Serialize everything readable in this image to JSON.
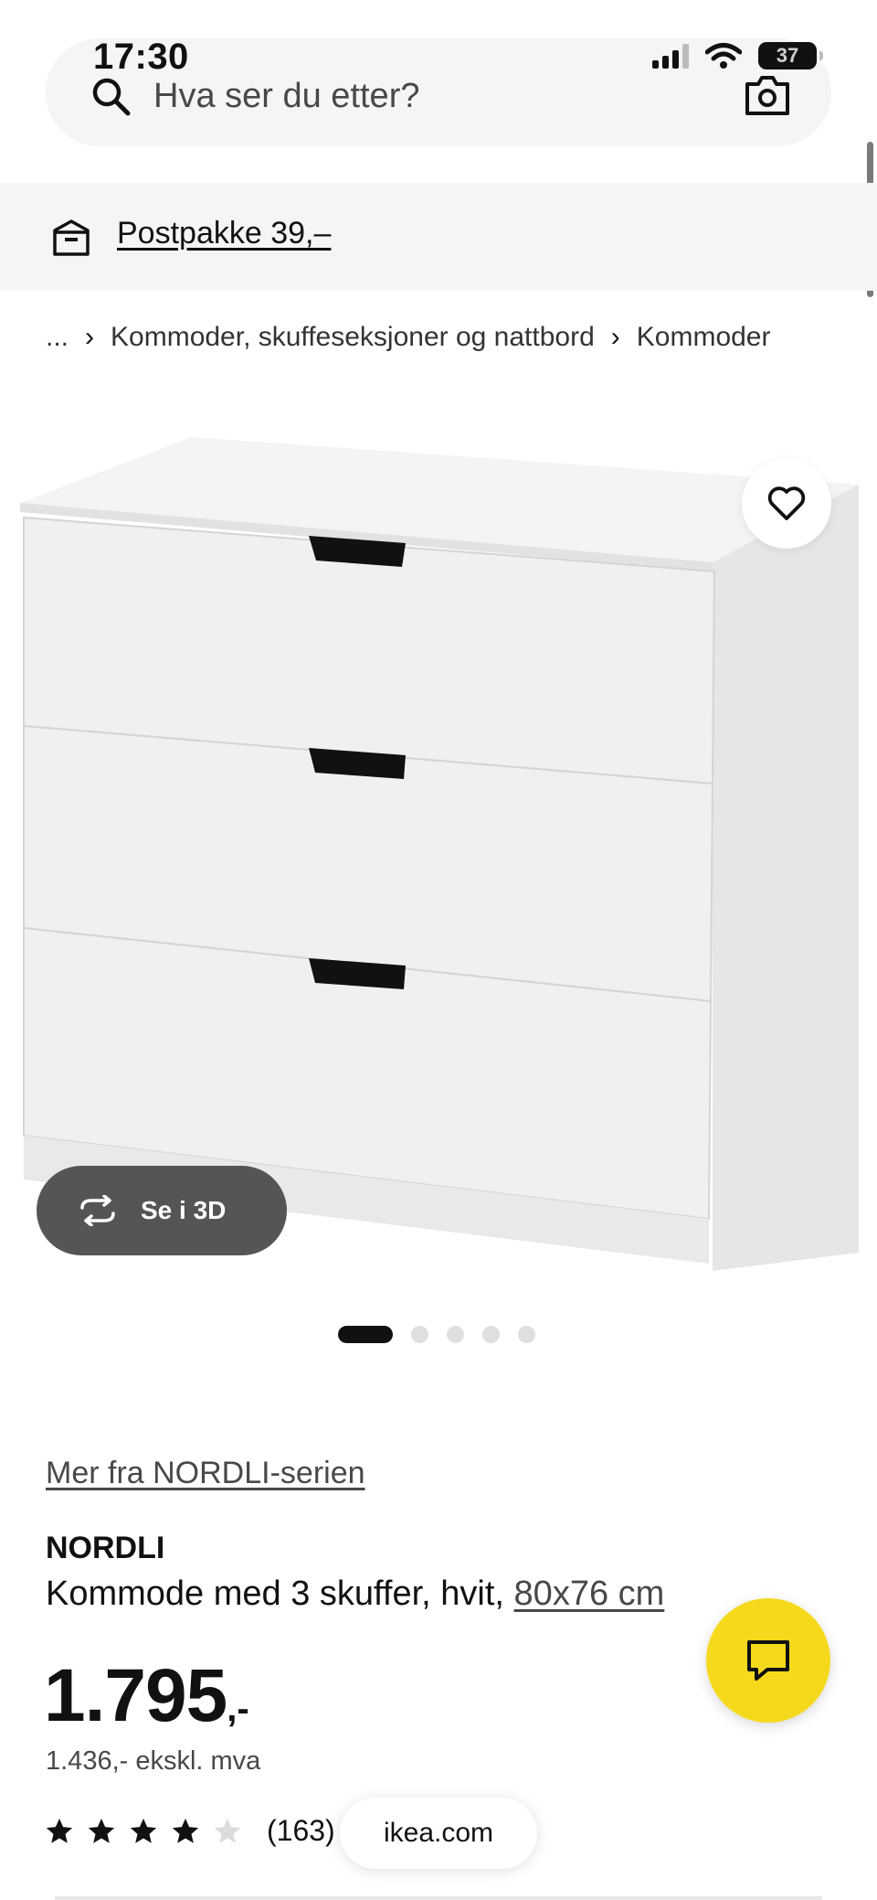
{
  "status_bar": {
    "time": "17:30",
    "battery": "37",
    "icons": [
      "cellular-signal-icon",
      "wifi-icon",
      "battery-icon"
    ]
  },
  "search": {
    "placeholder": "Hva ser du etter?",
    "icons": [
      "search-icon",
      "camera-icon"
    ]
  },
  "banner": {
    "label": "Postpakke 39,–",
    "icon": "parcel-box-icon"
  },
  "breadcrumb": {
    "ellipsis": "...",
    "items": [
      "Kommoder, skuffeseksjoner og nattbord",
      "Kommoder"
    ]
  },
  "gallery": {
    "view_3d_label": "Se i 3D",
    "image_count": 5,
    "active_index": 0
  },
  "product": {
    "series_link": "Mer fra NORDLI-serien",
    "name": "NORDLI",
    "description": "Kommode med 3 skuffer, hvit,",
    "size": "80x76 cm",
    "price_main": "1.795",
    "price_suffix": ",-",
    "price_ex_vat": "1.436,- ekskl. mva",
    "rating": 4,
    "rating_max": 5,
    "review_count": "(163)"
  },
  "browser": {
    "url": "ikea.com"
  },
  "colors": {
    "accent_yellow": "#f5d91c",
    "banner_bg": "#f5f5f5",
    "threed_button_bg": "#555555",
    "text_dark": "#111111",
    "text_muted": "#484848"
  }
}
